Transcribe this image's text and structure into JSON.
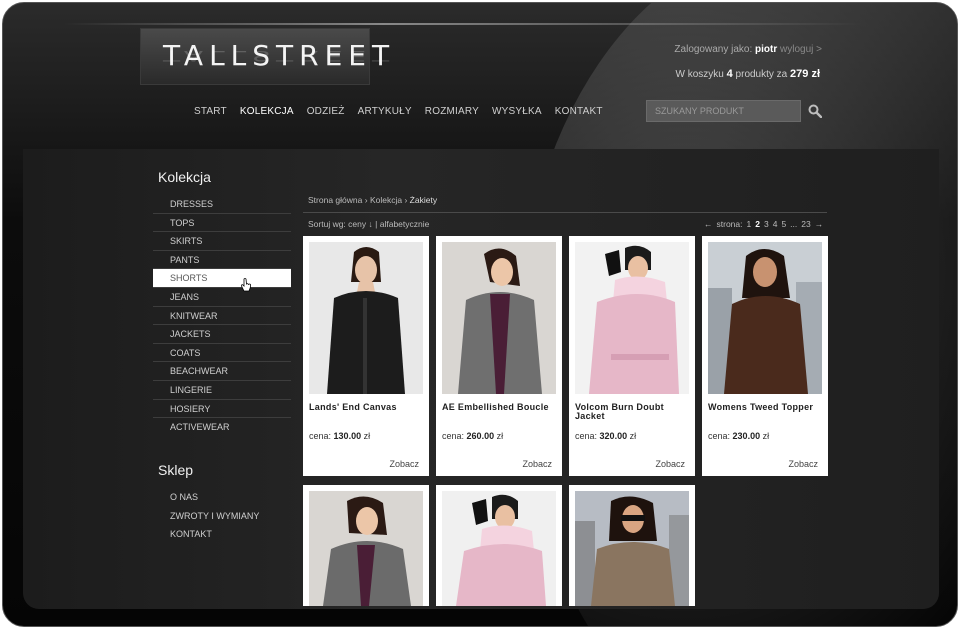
{
  "brand": {
    "name": "TALLSTREET"
  },
  "user": {
    "logged_label": "Zalogowany jako:",
    "username": "piotr",
    "logout": "wyloguj >"
  },
  "cart": {
    "prefix": "W koszyku",
    "count": "4",
    "mid": "produkty za",
    "total": "279 zł"
  },
  "nav": [
    "START",
    "KOLEKCJA",
    "ODZIEŻ",
    "ARTYKUŁY",
    "ROZMIARY",
    "WYSYŁKA",
    "KONTAKT"
  ],
  "search": {
    "placeholder": "SZUKANY PRODUKT"
  },
  "sidebar": {
    "collection_title": "Kolekcja",
    "collection_items": [
      "DRESSES",
      "TOPS",
      "SKIRTS",
      "PANTS",
      "SHORTS",
      "JEANS",
      "KNITWEAR",
      "JACKETS",
      "COATS",
      "BEACHWEAR",
      "LINGERIE",
      "HOSIERY",
      "ACTIVEWEAR"
    ],
    "shop_title": "Sklep",
    "shop_items": [
      "O NAS",
      "ZWROTY I WYMIANY",
      "KONTAKT"
    ]
  },
  "breadcrumb": {
    "home": "Strona główna",
    "sep": "›",
    "section": "Kolekcja",
    "current": "Żakiety"
  },
  "sort": {
    "label": "Sortuj wg:",
    "price": "ceny",
    "divider": "|",
    "alpha": "alfabetycznie"
  },
  "pager": {
    "prev": "←",
    "label": "strona:",
    "pages": [
      "1",
      "2",
      "3",
      "4",
      "5",
      "...",
      "23"
    ],
    "current": "2",
    "next": "→"
  },
  "products": [
    {
      "name": "Lands' End Canvas",
      "price_label": "cena:",
      "price": "130.00",
      "currency": "zł",
      "more": "Zobacz",
      "coat": "#1c1c1c",
      "bg": "#e8e8e8"
    },
    {
      "name": "AE Embellished Boucle",
      "price_label": "cena:",
      "price": "260.00",
      "currency": "zł",
      "more": "Zobacz",
      "coat": "#6f6f6f",
      "bg": "#d9d6d2"
    },
    {
      "name": "Volcom Burn Doubt Jacket",
      "price_label": "cena:",
      "price": "320.00",
      "currency": "zł",
      "more": "Zobacz",
      "coat": "#e6b7c8",
      "bg": "#f2f2f2"
    },
    {
      "name": "Womens Tweed Topper",
      "price_label": "cena:",
      "price": "230.00",
      "currency": "zł",
      "more": "Zobacz",
      "coat": "#4a2a1c",
      "bg": "#c9cfd4"
    },
    {
      "name": "",
      "coat": "#6b6b6b",
      "bg": "#d9d6d2"
    },
    {
      "name": "",
      "coat": "#e6b7c8",
      "bg": "#f0f0f0"
    },
    {
      "name": "",
      "coat": "#8a7560",
      "bg": "#b7bcc4"
    }
  ]
}
